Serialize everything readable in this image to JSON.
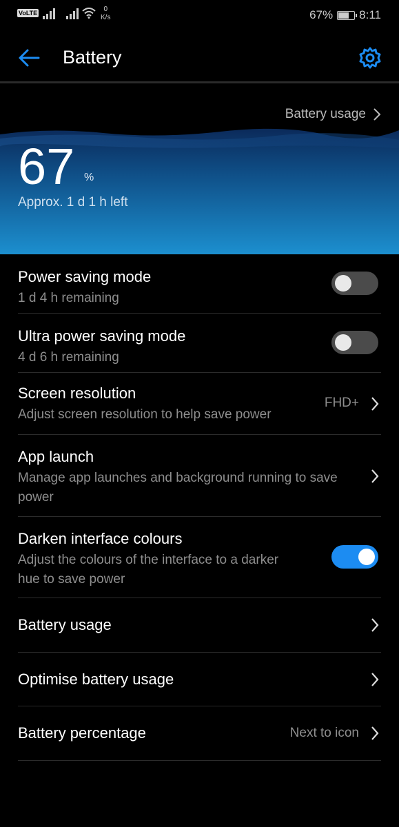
{
  "status_bar": {
    "volte": "VoLTE",
    "net_speed_value": "0",
    "net_speed_unit": "K/s",
    "battery_pct": "67%",
    "battery_level": 0.67,
    "time": "8:11"
  },
  "header": {
    "title": "Battery",
    "back_icon": "arrow-left-icon",
    "settings_icon": "gear-icon"
  },
  "hero": {
    "usage_link": "Battery usage",
    "percent": "67",
    "percent_sign": "%",
    "time_left": "Approx. 1 d 1 h left"
  },
  "settings": {
    "power_saving": {
      "title": "Power saving mode",
      "subtitle": "1 d 4 h remaining",
      "enabled": false
    },
    "ultra_power_saving": {
      "title": "Ultra power saving mode",
      "subtitle": "4 d 6 h remaining",
      "enabled": false
    },
    "screen_resolution": {
      "title": "Screen resolution",
      "subtitle": "Adjust screen resolution to help save power",
      "value": "FHD+"
    },
    "app_launch": {
      "title": "App launch",
      "subtitle_line1": "Manage app launches and background running to save",
      "subtitle_line2": "power"
    },
    "darken_colours": {
      "title": "Darken interface colours",
      "subtitle_line1": "Adjust the colours of the interface to a darker",
      "subtitle_line2": "hue to save power",
      "enabled": true
    },
    "battery_usage": {
      "title": "Battery usage"
    },
    "optimise_usage": {
      "title": "Optimise battery usage"
    },
    "battery_percentage": {
      "title": "Battery percentage",
      "value": "Next to icon"
    }
  },
  "colors": {
    "accent": "#1c8cf2",
    "background": "#000000",
    "hero_top": "#0b2a5a",
    "hero_bottom": "#1c8fcf"
  }
}
